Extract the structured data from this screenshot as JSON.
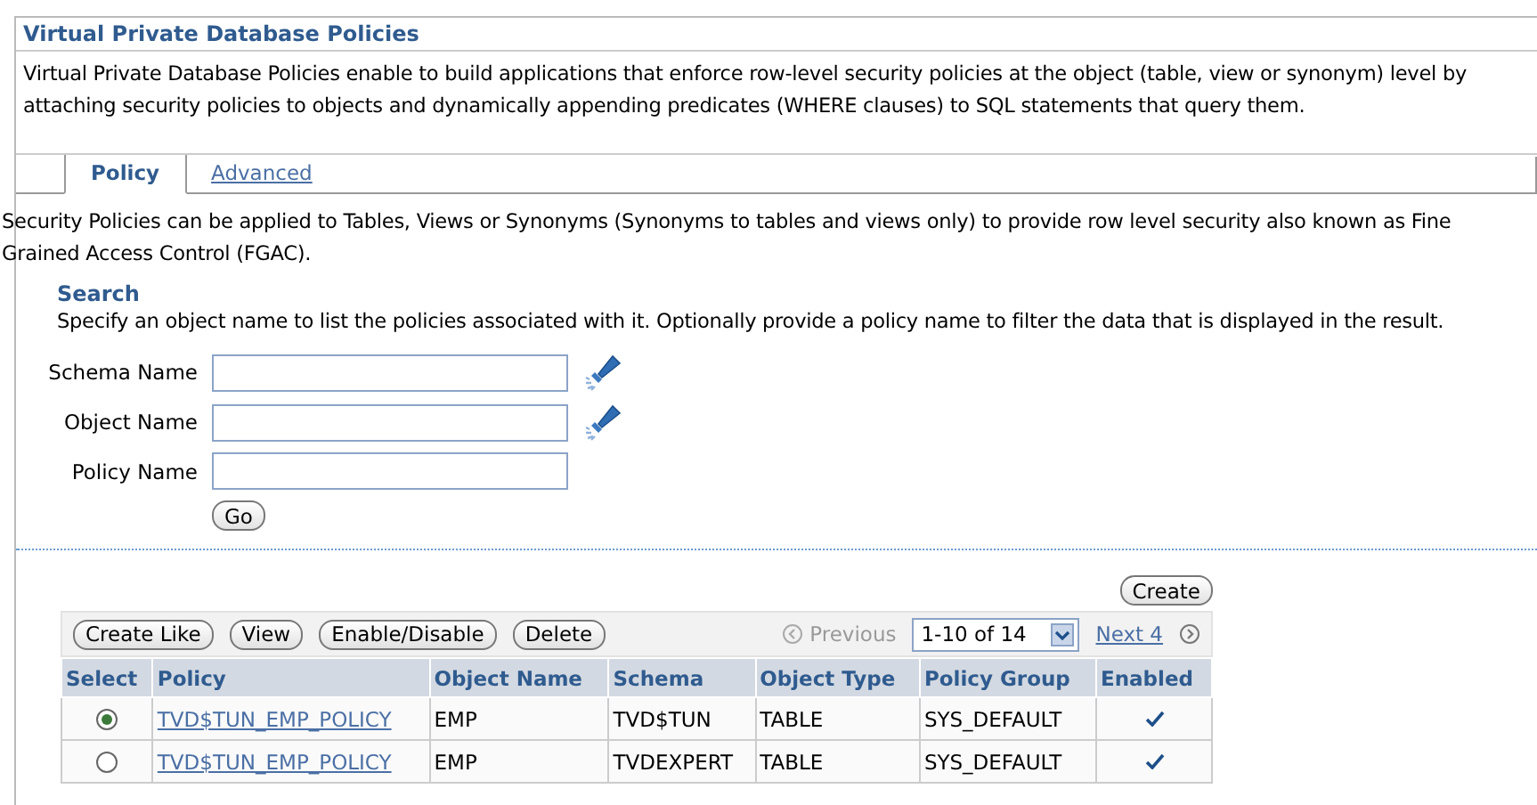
{
  "header": {
    "title": "Virtual Private Database Policies",
    "description": "Virtual Private Database Policies enable to build applications that enforce row-level security policies at the object (table, view or synonym) level by attaching security policies to objects and dynamically appending predicates (WHERE clauses) to SQL statements that query them."
  },
  "tabs": [
    {
      "label": "Policy",
      "selected": true
    },
    {
      "label": "Advanced",
      "selected": false
    }
  ],
  "intro": "Security Policies can be applied to Tables, Views or Synonyms (Synonyms to tables and views only) to provide row level security also known as Fine Grained Access Control (FGAC).",
  "search": {
    "title": "Search",
    "hint": "Specify an object name to list the policies associated with it. Optionally provide a policy name to filter the data that is displayed in the result.",
    "fields": [
      {
        "label": "Schema Name",
        "lookup": true
      },
      {
        "label": "Object Name",
        "lookup": true
      },
      {
        "label": "Policy Name",
        "lookup": false
      }
    ],
    "go": "Go"
  },
  "create": "Create",
  "toolbar": {
    "buttons": [
      "Create Like",
      "View",
      "Enable/Disable",
      "Delete"
    ],
    "previous": "Previous",
    "range": "1-10 of 14",
    "next": "Next 4"
  },
  "table": {
    "columns": [
      "Select",
      "Policy",
      "Object Name",
      "Schema",
      "Object Type",
      "Policy Group",
      "Enabled"
    ],
    "rows": [
      {
        "selected": true,
        "policy": "TVD$TUN_EMP_POLICY",
        "object": "EMP",
        "schema": "TVD$TUN",
        "type": "TABLE",
        "group": "SYS_DEFAULT",
        "enabled": true
      },
      {
        "selected": false,
        "policy": "TVD$TUN_EMP_POLICY",
        "object": "EMP",
        "schema": "TVDEXPERT",
        "type": "TABLE",
        "group": "SYS_DEFAULT",
        "enabled": true
      }
    ]
  }
}
